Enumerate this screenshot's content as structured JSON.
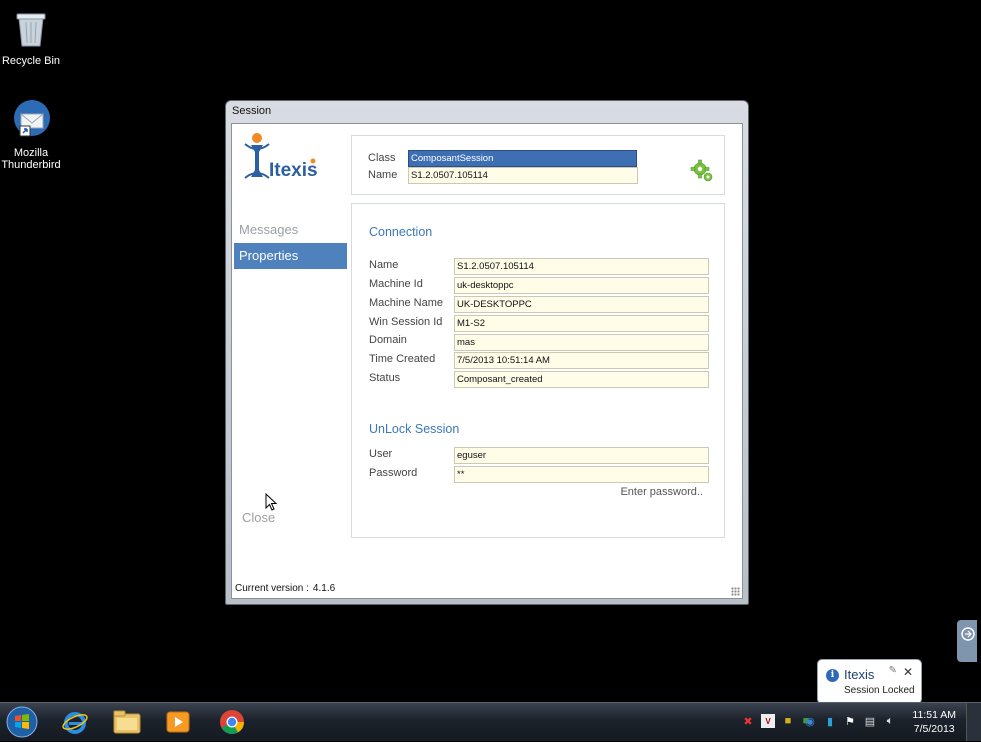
{
  "desktop": {
    "icons": [
      {
        "label": "Recycle Bin",
        "icon": "recycle-bin-icon"
      },
      {
        "label": "Mozilla Thunderbird",
        "icon": "thunderbird-icon"
      }
    ]
  },
  "window": {
    "title": "Session",
    "logo_text": "Itexis",
    "nav": {
      "messages": "Messages",
      "properties": "Properties",
      "close": "Close"
    },
    "header": {
      "class_label": "Class",
      "class_value": "ComposantSession",
      "name_label": "Name",
      "name_value": "S1.2.0507.105114"
    },
    "connection": {
      "title": "Connection",
      "rows": [
        {
          "label": "Name",
          "value": "S1.2.0507.105114"
        },
        {
          "label": "Machine Id",
          "value": "uk-desktoppc"
        },
        {
          "label": "Machine Name",
          "value": "UK-DESKTOPPC"
        },
        {
          "label": "Win Session Id",
          "value": "M1-S2"
        },
        {
          "label": "Domain",
          "value": "mas"
        },
        {
          "label": "Time Created",
          "value": "7/5/2013 10:51:14 AM"
        },
        {
          "label": "Status",
          "value": "Composant_created"
        }
      ]
    },
    "unlock": {
      "title": "UnLock Session",
      "user_label": "User",
      "user_value": "eguser",
      "password_label": "Password",
      "password_value": "**",
      "hint": "Enter password.."
    },
    "version_label": "Current version :",
    "version_value": "4.1.6"
  },
  "taskbar": {
    "time": "11:51 AM",
    "date": "7/5/2013",
    "pinned": [
      "internet-explorer-icon",
      "file-explorer-icon",
      "media-player-icon",
      "chrome-icon"
    ]
  },
  "notification": {
    "title": "Itexis",
    "message": "Session Locked"
  },
  "colors": {
    "accent": "#4f81bd",
    "section_title": "#3d78b8",
    "field_bg": "#fffde7"
  }
}
